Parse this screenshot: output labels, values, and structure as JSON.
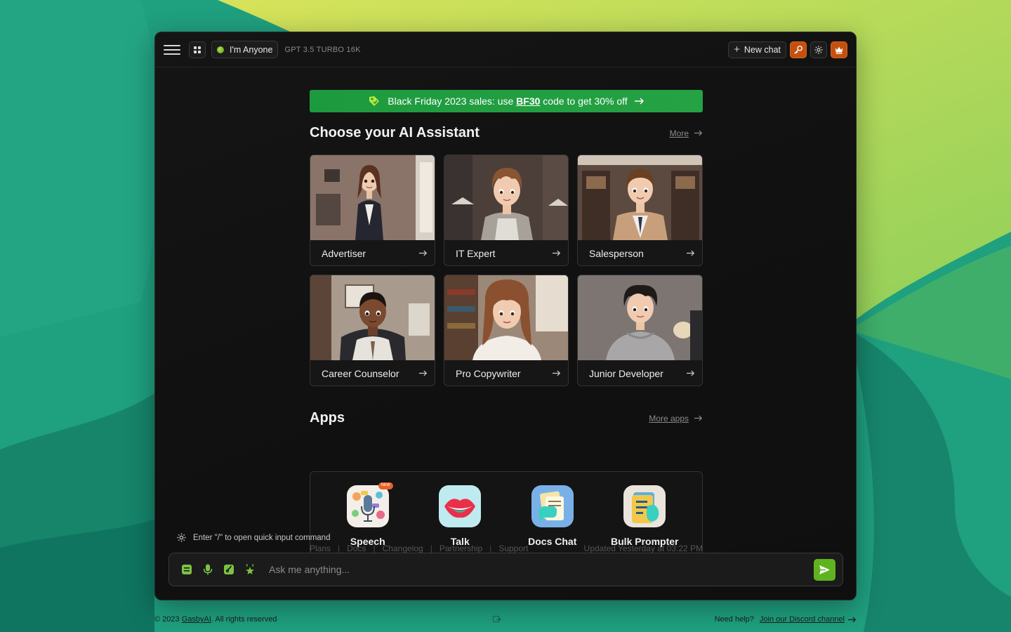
{
  "topbar": {
    "persona_label": "I'm Anyone",
    "model_label": "GPT 3.5 TURBO 16K",
    "new_chat_label": "New chat"
  },
  "promo": {
    "prefix": "Black Friday 2023 sales: use ",
    "code": "BF30",
    "suffix": " code to get 30% off"
  },
  "assistants": {
    "title": "Choose your AI Assistant",
    "more_label": "More",
    "items": [
      {
        "label": "Advertiser"
      },
      {
        "label": "IT Expert"
      },
      {
        "label": "Salesperson"
      },
      {
        "label": "Career Counselor"
      },
      {
        "label": "Pro Copywriter"
      },
      {
        "label": "Junior Developer"
      }
    ]
  },
  "apps": {
    "title": "Apps",
    "more_label": "More apps",
    "items": [
      {
        "label": "Speech",
        "badge": "NEW"
      },
      {
        "label": "Talk"
      },
      {
        "label": "Docs Chat"
      },
      {
        "label": "Bulk Prompter"
      }
    ]
  },
  "quick_hint": "Enter \"/\" to open quick input command",
  "footer_links": {
    "items": [
      "Plans",
      "Docs",
      "Changelog",
      "Partnership",
      "Support"
    ],
    "updated": "Updated Yesterday at 03:22 PM"
  },
  "input": {
    "placeholder": "Ask me anything..."
  },
  "page_footer": {
    "copyright_prefix": "© 2023 ",
    "brand": "GasbyAI",
    "copyright_suffix": ". All rights reserved",
    "help_prefix": "Need help? ",
    "help_link": "Join our Discord channel"
  },
  "colors": {
    "accent_green": "#5fb320",
    "promo_green": "#22a041",
    "orange": "#c2510f",
    "background_teal": "#1f9c7c"
  }
}
